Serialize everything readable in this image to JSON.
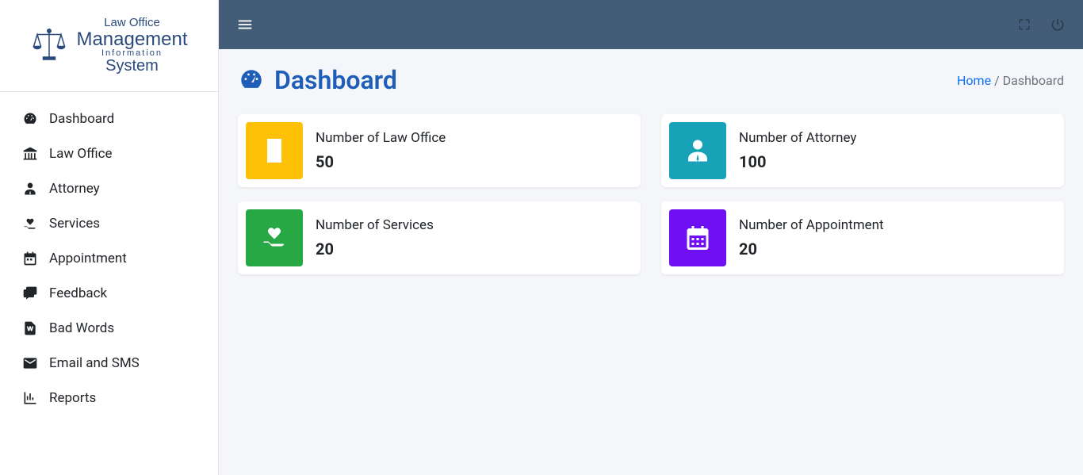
{
  "logo": {
    "line1": "Law Office",
    "line2": "Management",
    "line3": "Information",
    "line4": "System"
  },
  "sidebar": {
    "items": [
      {
        "label": "Dashboard"
      },
      {
        "label": "Law Office"
      },
      {
        "label": "Attorney"
      },
      {
        "label": "Services"
      },
      {
        "label": "Appointment"
      },
      {
        "label": "Feedback"
      },
      {
        "label": "Bad Words"
      },
      {
        "label": "Email and SMS"
      },
      {
        "label": "Reports"
      }
    ]
  },
  "header": {
    "title": "Dashboard",
    "breadcrumb_home": "Home",
    "breadcrumb_sep": " / ",
    "breadcrumb_current": "Dashboard"
  },
  "cards": [
    {
      "label": "Number of Law Office",
      "value": "50"
    },
    {
      "label": "Number of Attorney",
      "value": "100"
    },
    {
      "label": "Number of Services",
      "value": "20"
    },
    {
      "label": "Number of Appointment",
      "value": "20"
    }
  ]
}
